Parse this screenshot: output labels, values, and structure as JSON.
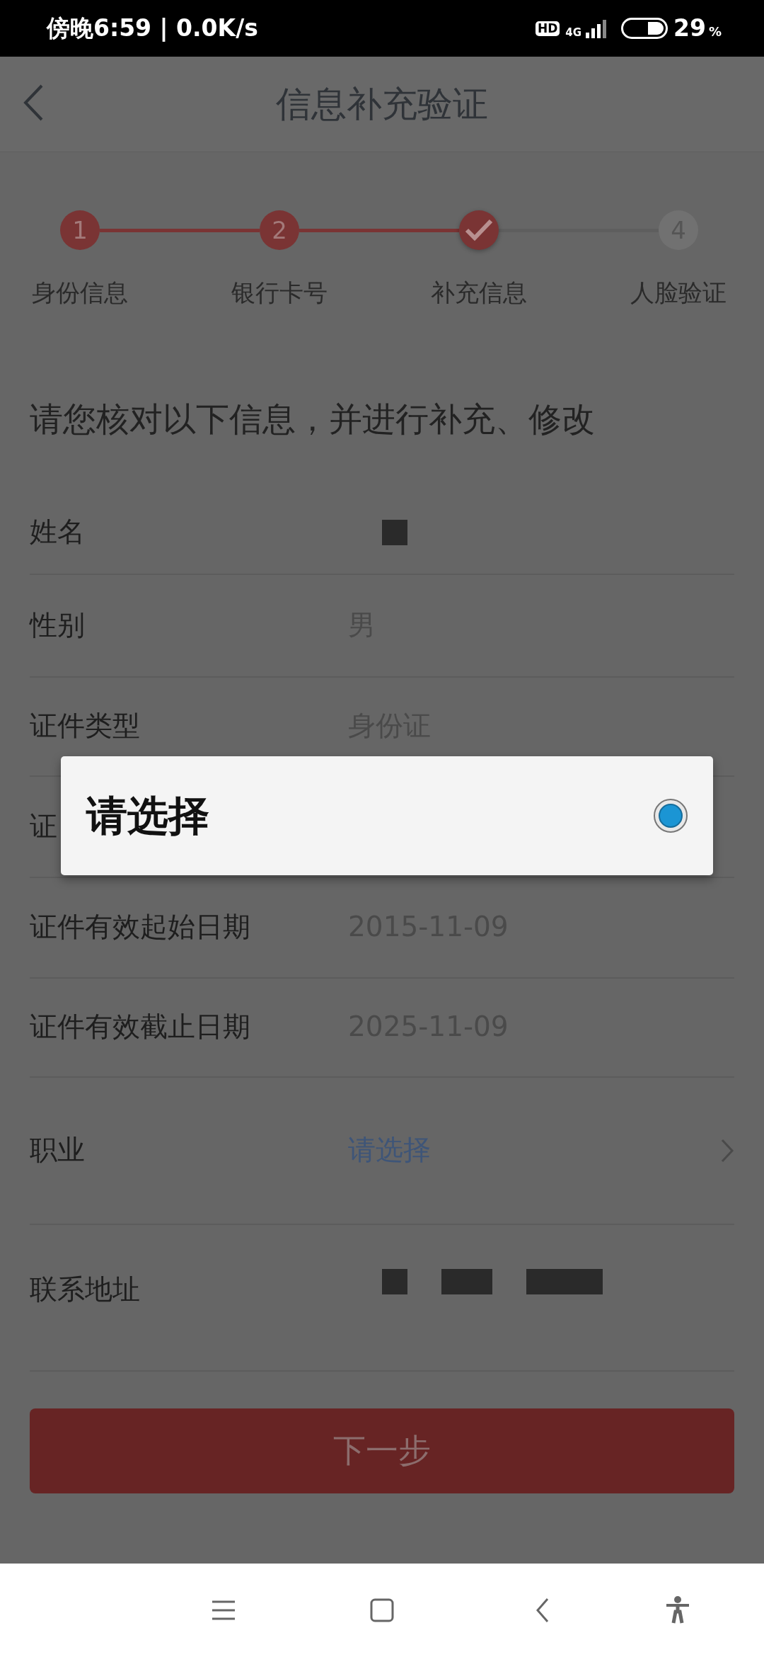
{
  "status_bar": {
    "time": "傍晚6:59 | 0.0K/s",
    "hd": "HD",
    "network": "4G",
    "battery": "29",
    "battery_unit": "%"
  },
  "header": {
    "title": "信息补充验证"
  },
  "steps": [
    {
      "number": "1",
      "label": "身份信息",
      "done": true,
      "current": false
    },
    {
      "number": "2",
      "label": "银行卡号",
      "done": true,
      "current": false
    },
    {
      "label": "补充信息",
      "done": false,
      "current": true
    },
    {
      "number": "4",
      "label": "人脸验证",
      "done": false,
      "current": false
    }
  ],
  "intro": "请您核对以下信息，并进行补充、修改",
  "rows": [
    {
      "kind": "redacted",
      "label": "姓名"
    },
    {
      "kind": "text",
      "label": "性别",
      "value": "男"
    },
    {
      "kind": "text",
      "label": "证件类型",
      "value": "身份证"
    },
    {
      "kind": "hidden",
      "label": "证"
    },
    {
      "kind": "text",
      "label": "证件有效起始日期",
      "value": "2015-11-09"
    },
    {
      "kind": "text",
      "label": "证件有效截止日期",
      "value": "2025-11-09"
    },
    {
      "kind": "select",
      "label": "职业",
      "value": "请选择"
    },
    {
      "kind": "redacted",
      "label": "联系地址"
    }
  ],
  "next_button": {
    "label": "下一步",
    "disabled": true
  },
  "dialog": {
    "option": "请选择",
    "selected": true
  }
}
